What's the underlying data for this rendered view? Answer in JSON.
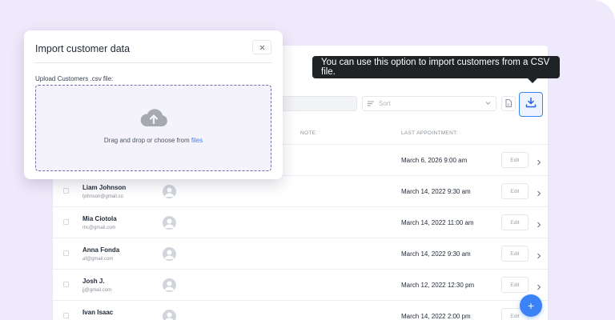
{
  "toolbar": {
    "sort_placeholder": "Sort",
    "csv_icon": "file-csv-icon",
    "import_icon": "download-icon"
  },
  "table": {
    "columns": [
      "NOTE:",
      "LAST APPOINTMENT:"
    ],
    "rows": [
      {
        "name": "",
        "email": "",
        "appointment": "March 6, 2026 9:00 am",
        "edit": "Edit"
      },
      {
        "name": "Liam Johnson",
        "email": "ljohnson@gmail.co",
        "appointment": "March 14, 2022 9:30 am",
        "edit": "Edit"
      },
      {
        "name": "Mia Ciotola",
        "email": "mc@gmail.com",
        "appointment": "March 14, 2022 11:00 am",
        "edit": "Edit"
      },
      {
        "name": "Anna Fonda",
        "email": "af@gmail.com",
        "appointment": "March 14, 2022 9:30 am",
        "edit": "Edit"
      },
      {
        "name": "Josh J.",
        "email": "jj@gmail.com",
        "appointment": "March 12, 2022 12:30 pm",
        "edit": "Edit"
      },
      {
        "name": "Ivan Isaac",
        "email": "",
        "appointment": "March 14, 2022 2:00 pm",
        "edit": "Edit"
      }
    ]
  },
  "fab": {
    "label": "+"
  },
  "tooltip": {
    "text": "You can use this option to import customers from a CSV file."
  },
  "modal": {
    "title": "Import customer data",
    "close_label": "×",
    "upload_label": "Upload Customers .csv file:",
    "drop_hint": "Drag and drop or choose from ",
    "drop_link": "files"
  },
  "colors": {
    "accent": "#3b82f6",
    "background": "#efeafb",
    "tooltip_bg": "#1f2326"
  }
}
